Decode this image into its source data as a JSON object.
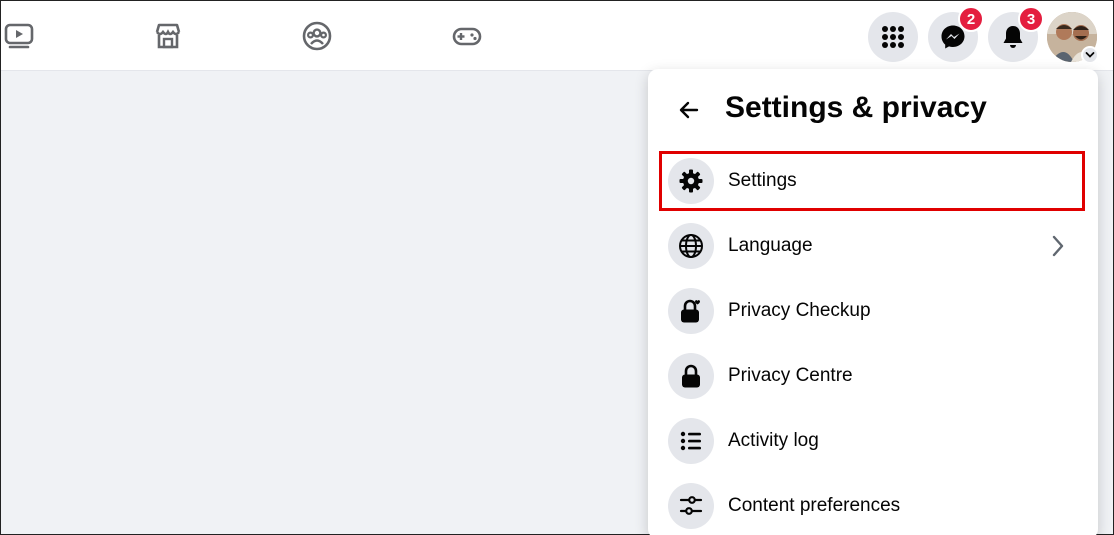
{
  "topbar": {
    "nav_icons": [
      "watch-icon",
      "marketplace-icon",
      "groups-icon",
      "gaming-icon"
    ],
    "menu_icon": "grid-menu-icon",
    "messenger": {
      "icon": "messenger-icon",
      "badge": "2"
    },
    "notifications": {
      "icon": "bell-icon",
      "badge": "3"
    },
    "account": {
      "icon": "avatar",
      "chevron": "chevron-down-icon"
    }
  },
  "panel": {
    "title": "Settings & privacy",
    "back_icon": "back-arrow-icon",
    "items": [
      {
        "label": "Settings",
        "icon": "gear-icon"
      },
      {
        "label": "Language",
        "icon": "globe-icon",
        "has_submenu": true
      },
      {
        "label": "Privacy Checkup",
        "icon": "lock-heart-icon"
      },
      {
        "label": "Privacy Centre",
        "icon": "lock-icon"
      },
      {
        "label": "Activity log",
        "icon": "list-icon"
      },
      {
        "label": "Content preferences",
        "icon": "sliders-icon"
      }
    ]
  },
  "annotation": {
    "highlight_color": "#e00000",
    "highlighted_item": "Settings"
  },
  "colors": {
    "badge": "#e41e3f",
    "background": "#f0f2f5",
    "icon_circle": "#e4e6eb"
  }
}
